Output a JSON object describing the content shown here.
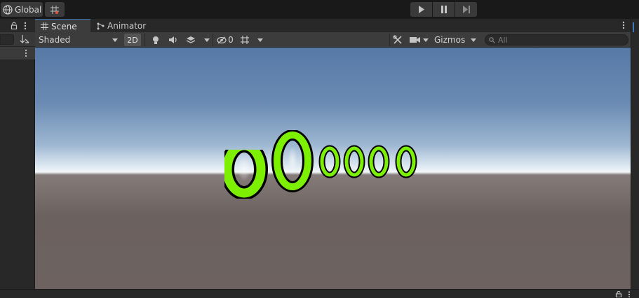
{
  "toolbar": {
    "global_label": "Global",
    "global_icon": "globe-icon",
    "grid_snap_icon": "grid-snap-icon",
    "play_icon": "play-icon",
    "pause_icon": "pause-icon",
    "step_icon": "step-icon"
  },
  "tabs": [
    {
      "label": "Scene",
      "icon": "scene-grid-icon",
      "active": true
    },
    {
      "label": "Animator",
      "icon": "animator-icon",
      "active": false
    }
  ],
  "scene_toolbar": {
    "draw_mode": "Shaded",
    "mode_2d": "2D",
    "hidden_count": "0",
    "gizmos_label": "Gizmos",
    "search_placeholder": "All"
  },
  "viewport": {
    "score_digits": [
      "0",
      "0",
      "0",
      "0",
      "0",
      "0"
    ],
    "digit_color": "#7cf000",
    "outline_color": "#000000"
  },
  "colors": {
    "accent": "#3a79bb",
    "panel_bg": "#282828",
    "toolbar_bg": "#3c3c3c"
  }
}
